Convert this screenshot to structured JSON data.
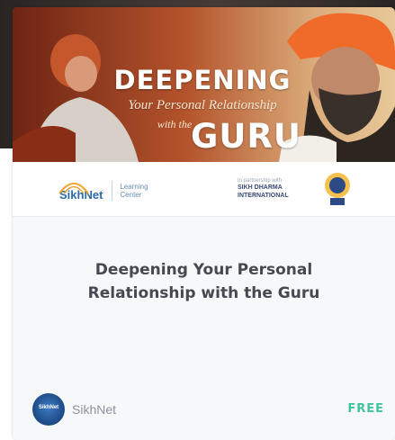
{
  "card": {
    "banner": {
      "title_line_1": "DEEPENING",
      "subtitle_line_1": "Your Personal Relationship",
      "subtitle_line_2": "with the",
      "title_line_2": "GURU"
    },
    "logos": {
      "left_brand": "SikhNet",
      "left_program_line_1": "Learning",
      "left_program_line_2": "Center",
      "right_small": "In partnership with",
      "right_name_line_1": "SIKH DHARMA",
      "right_name_line_2": "INTERNATIONAL"
    },
    "course_title_line_1": "Deepening Your Personal",
    "course_title_line_2": "Relationship with the Guru",
    "author": {
      "name": "SikhNet",
      "avatar_text": "SikhNet"
    },
    "price": "FREE",
    "colors": {
      "price": "#3fc49a",
      "title_text": "#444a50",
      "brand_blue": "#2b6aa7"
    }
  }
}
